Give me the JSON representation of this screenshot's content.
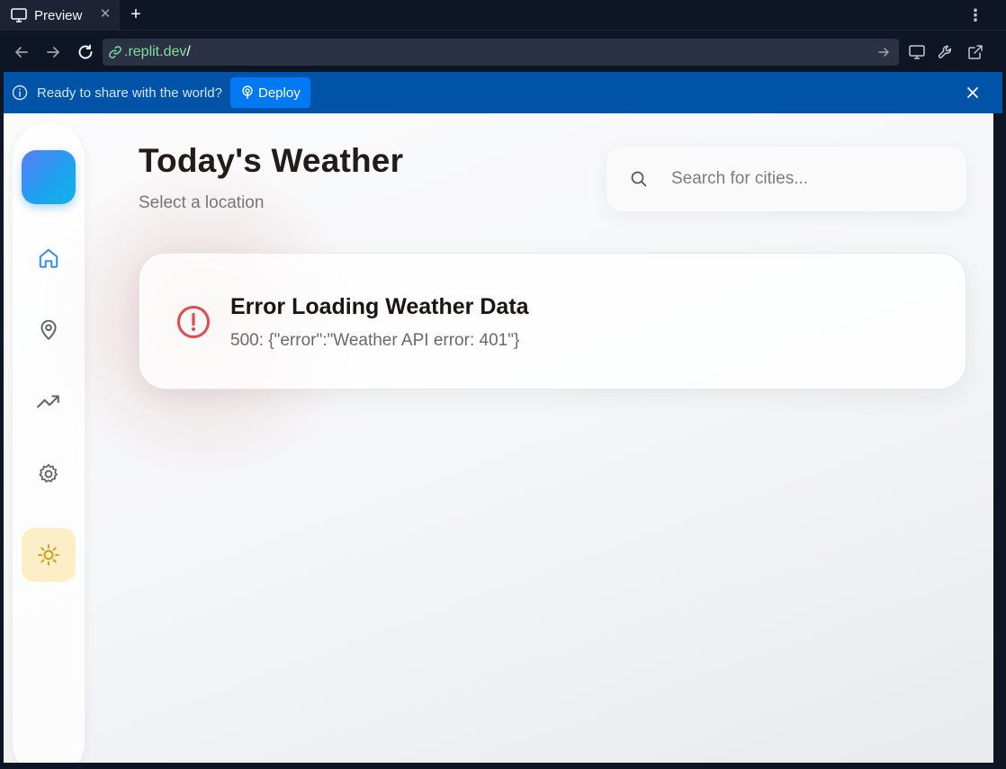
{
  "tab": {
    "label": "Preview",
    "close": "✕",
    "add": "+",
    "icon": "monitor-icon"
  },
  "menu": {
    "label": "⋮"
  },
  "address": {
    "url_domain": ".replit.dev",
    "url_path": "/"
  },
  "banner": {
    "text": "Ready to share with the world?",
    "deploy_label": "Deploy"
  },
  "page": {
    "title": "Today's Weather",
    "subtitle": "Select a location",
    "search_placeholder": "Search for cities..."
  },
  "error": {
    "title": "Error Loading Weather Data",
    "message": "500: {\"error\":\"Weather API error: 401\"}"
  },
  "sidebar": {
    "items": [
      {
        "icon": "home-icon"
      },
      {
        "icon": "map-pin-icon"
      },
      {
        "icon": "trending-up-icon"
      },
      {
        "icon": "settings-icon"
      },
      {
        "icon": "sun-icon"
      }
    ]
  },
  "colors": {
    "accent_blue": "#0079f2",
    "banner_blue": "#0053a6",
    "error_red": "#e5484d",
    "sun_amber": "#d4a017",
    "home_blue": "#3b8ee8"
  }
}
